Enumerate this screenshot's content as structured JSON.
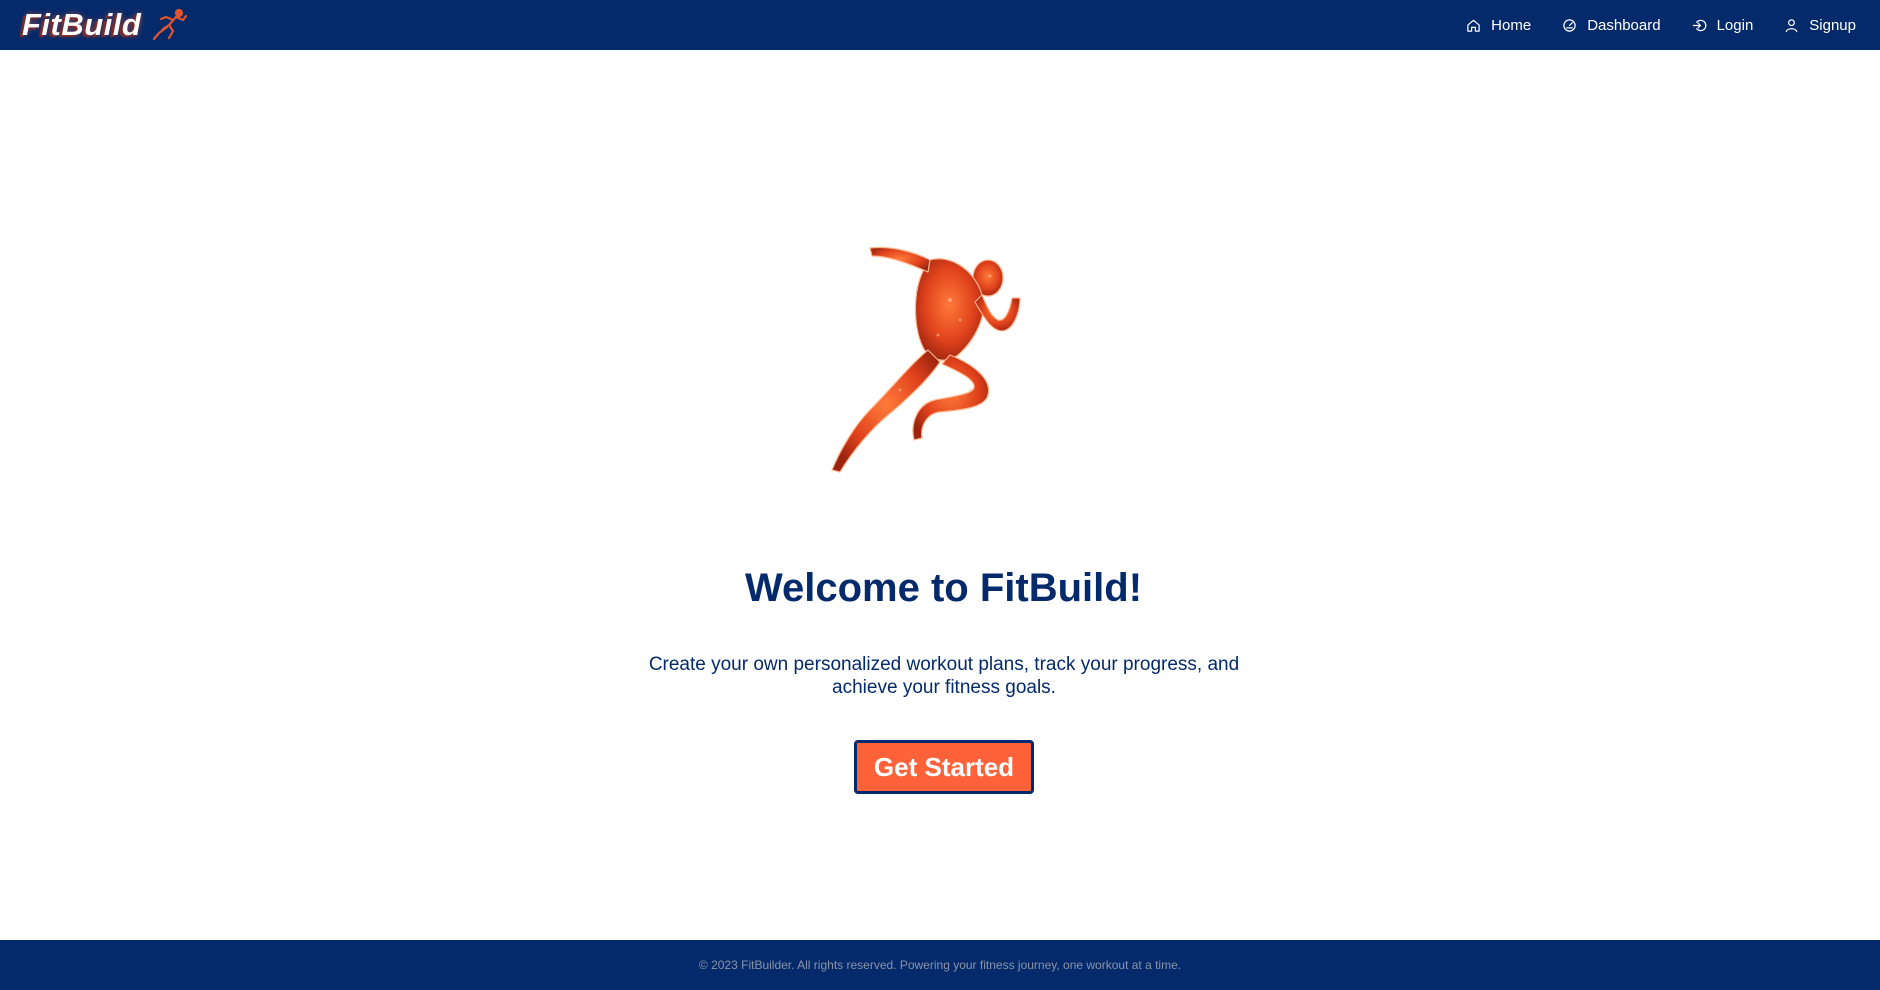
{
  "brand": {
    "name": "FitBuild",
    "logo_icon": "runner-icon"
  },
  "nav": {
    "items": [
      {
        "label": "Home",
        "icon": "home-icon"
      },
      {
        "label": "Dashboard",
        "icon": "dashboard-icon"
      },
      {
        "label": "Login",
        "icon": "login-icon"
      },
      {
        "label": "Signup",
        "icon": "user-icon"
      }
    ]
  },
  "hero": {
    "image": "sprinting-runner-illustration",
    "title": "Welcome to FitBuild!",
    "subtitle": "Create your own personalized workout plans, track your progress, and achieve your fitness goals.",
    "cta_label": "Get Started"
  },
  "footer": {
    "text": "© 2023 FitBuilder. All rights reserved. Powering your fitness journey, one workout at a time."
  },
  "colors": {
    "primary": "#042a6b",
    "accent": "#ff6138",
    "background": "#ffffff"
  }
}
